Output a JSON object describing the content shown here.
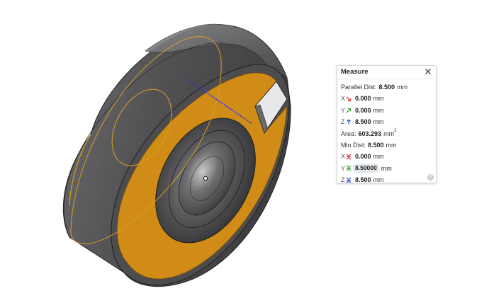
{
  "measure": {
    "title": "Measure",
    "parallel": {
      "label": "Parallel Dist:",
      "value": "8.500",
      "unit": "mm"
    },
    "parallel_x": {
      "axis": "X",
      "value": "0.000",
      "unit": "mm"
    },
    "parallel_y": {
      "axis": "Y",
      "value": "0.000",
      "unit": "mm"
    },
    "parallel_z": {
      "axis": "Z",
      "value": "8.500",
      "unit": "mm"
    },
    "area": {
      "label": "Area:",
      "value": "603.293",
      "unit": "mm",
      "unit_sup": "2"
    },
    "min": {
      "label": "Min Dist:",
      "value": "8.500",
      "unit": "mm"
    },
    "min_x": {
      "axis": "X",
      "value": "0.000",
      "unit": "mm"
    },
    "min_y": {
      "axis": "Y",
      "value": "8.50000",
      "unit": "mm"
    },
    "min_z": {
      "axis": "Z",
      "value": "8.500",
      "unit": "mm"
    },
    "help": "?"
  },
  "colors": {
    "model_gray": "#5a5a5c",
    "selected_face": "#d18c17",
    "measure_line": "#2b2bd9",
    "x_axis": "#d63a3a",
    "y_axis": "#3aa53a",
    "z_axis": "#3a4fd6"
  },
  "icons": {
    "close": "close-icon",
    "help": "help-icon",
    "x_arrow": "x-axis-arrow-icon",
    "y_arrow": "y-axis-arrow-icon",
    "z_arrow": "z-axis-arrow-icon"
  }
}
